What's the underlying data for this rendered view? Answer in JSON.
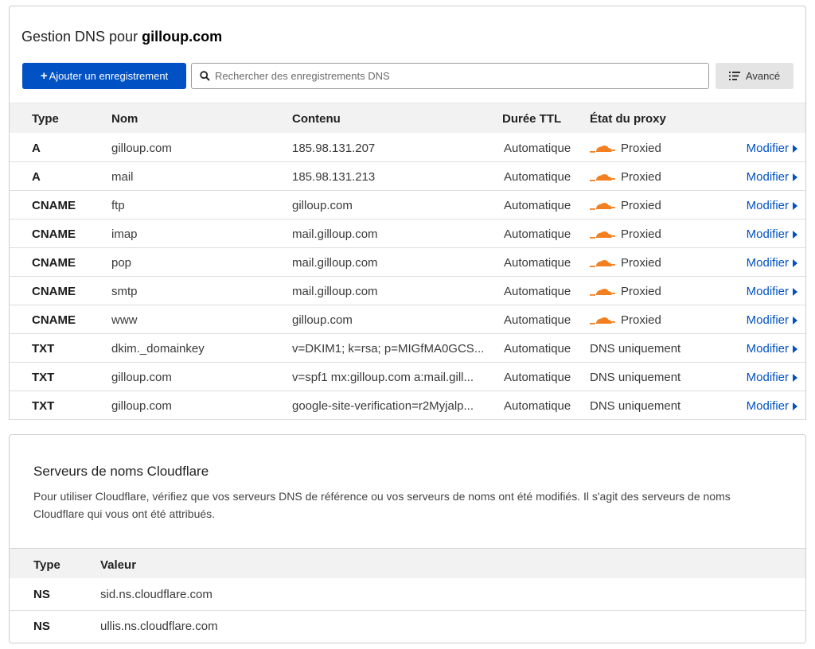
{
  "header": {
    "title_prefix": "Gestion DNS pour",
    "domain": "gilloup.com"
  },
  "toolbar": {
    "add_label": "Ajouter un enregistrement",
    "search_placeholder": "Rechercher des enregistrements DNS",
    "advanced_label": "Avancé"
  },
  "table": {
    "columns": {
      "type": "Type",
      "name": "Nom",
      "content": "Contenu",
      "ttl": "Durée TTL",
      "proxy": "État du proxy"
    },
    "edit_label": "Modifier",
    "records": [
      {
        "type": "A",
        "name": "gilloup.com",
        "content": "185.98.131.207",
        "ttl": "Automatique",
        "proxy": "Proxied",
        "proxied": true
      },
      {
        "type": "A",
        "name": "mail",
        "content": "185.98.131.213",
        "ttl": "Automatique",
        "proxy": "Proxied",
        "proxied": true
      },
      {
        "type": "CNAME",
        "name": "ftp",
        "content": "gilloup.com",
        "ttl": "Automatique",
        "proxy": "Proxied",
        "proxied": true
      },
      {
        "type": "CNAME",
        "name": "imap",
        "content": "mail.gilloup.com",
        "ttl": "Automatique",
        "proxy": "Proxied",
        "proxied": true
      },
      {
        "type": "CNAME",
        "name": "pop",
        "content": "mail.gilloup.com",
        "ttl": "Automatique",
        "proxy": "Proxied",
        "proxied": true
      },
      {
        "type": "CNAME",
        "name": "smtp",
        "content": "mail.gilloup.com",
        "ttl": "Automatique",
        "proxy": "Proxied",
        "proxied": true
      },
      {
        "type": "CNAME",
        "name": "www",
        "content": "gilloup.com",
        "ttl": "Automatique",
        "proxy": "Proxied",
        "proxied": true
      },
      {
        "type": "TXT",
        "name": "dkim._domainkey",
        "content": "v=DKIM1; k=rsa; p=MIGfMA0GCS...",
        "ttl": "Automatique",
        "proxy": "DNS uniquement",
        "proxied": false
      },
      {
        "type": "TXT",
        "name": "gilloup.com",
        "content": "v=spf1 mx:gilloup.com a:mail.gill...",
        "ttl": "Automatique",
        "proxy": "DNS uniquement",
        "proxied": false
      },
      {
        "type": "TXT",
        "name": "gilloup.com",
        "content": "google-site-verification=r2Myjalp...",
        "ttl": "Automatique",
        "proxy": "DNS uniquement",
        "proxied": false
      }
    ]
  },
  "nameservers": {
    "title": "Serveurs de noms Cloudflare",
    "description": "Pour utiliser Cloudflare, vérifiez que vos serveurs DNS de référence ou vos serveurs de noms ont été modifiés. Il s'agit des serveurs de noms Cloudflare qui vous ont été attribués.",
    "columns": {
      "type": "Type",
      "value": "Valeur"
    },
    "rows": [
      {
        "type": "NS",
        "value": "sid.ns.cloudflare.com"
      },
      {
        "type": "NS",
        "value": "ullis.ns.cloudflare.com"
      }
    ]
  },
  "colors": {
    "primary": "#0051c3",
    "cloud": "#f38020",
    "link": "#0051c3"
  },
  "icons": {
    "search": "search-icon",
    "advanced": "filter-list-icon",
    "cloud": "cloud-icon",
    "edit": "caret-right-icon"
  }
}
